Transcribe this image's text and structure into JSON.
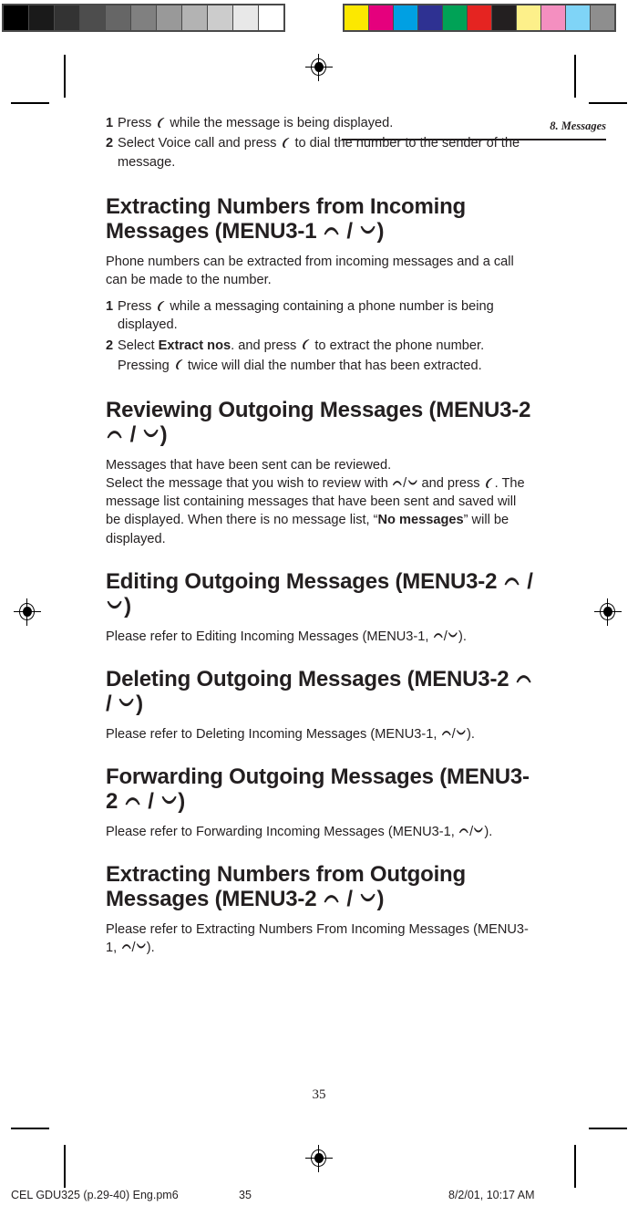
{
  "calibration": {
    "gray_bar": {
      "name": "grayscale-step-wedge",
      "swatches": [
        "#000000",
        "#1a1a1a",
        "#333333",
        "#4d4d4d",
        "#666666",
        "#808080",
        "#999999",
        "#b3b3b3",
        "#cccccc",
        "#e8e8e8",
        "#ffffff"
      ]
    },
    "color_bar": {
      "name": "process-color-bar",
      "swatches": [
        "#fce800",
        "#e5007d",
        "#00a0e3",
        "#2e3192",
        "#00a256",
        "#e52421",
        "#231f20",
        "#fdf08a",
        "#f48fc0",
        "#7fd4f7",
        "#8e8e8e"
      ]
    }
  },
  "header": {
    "running_head": "8. Messages"
  },
  "sections": [
    {
      "type": "steps",
      "name": "voice-call-steps",
      "items": [
        {
          "num": "1",
          "parts": [
            {
              "t": "text",
              "v": "Press "
            },
            {
              "t": "icon",
              "v": "send-key-icon"
            },
            {
              "t": "text",
              "v": " while the message is being displayed."
            }
          ]
        },
        {
          "num": "2",
          "parts": [
            {
              "t": "text",
              "v": "Select Voice call and press "
            },
            {
              "t": "icon",
              "v": "send-key-icon"
            },
            {
              "t": "text",
              "v": " to dial the number to the sender of the message."
            }
          ]
        }
      ]
    },
    {
      "type": "section",
      "name": "extracting-numbers-incoming",
      "heading": [
        {
          "t": "text",
          "v": "Extracting Numbers from Incoming Messages (MENU3-1 "
        },
        {
          "t": "icon",
          "v": "scroll-up-icon"
        },
        {
          "t": "text",
          "v": " / "
        },
        {
          "t": "icon",
          "v": "scroll-down-icon"
        },
        {
          "t": "text",
          "v": ")"
        }
      ],
      "paragraphs": [
        [
          {
            "t": "text",
            "v": "Phone numbers can be extracted from incoming messages and a call can be made to the number."
          }
        ]
      ],
      "steps": [
        {
          "num": "1",
          "parts": [
            {
              "t": "text",
              "v": "Press "
            },
            {
              "t": "icon",
              "v": "send-key-icon"
            },
            {
              "t": "text",
              "v": " while a messaging containing a phone number is being displayed."
            }
          ]
        },
        {
          "num": "2",
          "parts": [
            {
              "t": "text",
              "v": "Select "
            },
            {
              "t": "bold",
              "v": "Extract nos"
            },
            {
              "t": "text",
              "v": ". and press "
            },
            {
              "t": "icon",
              "v": "send-key-icon"
            },
            {
              "t": "text",
              "v": " to extract the phone number."
            }
          ]
        },
        {
          "num": "",
          "parts": [
            {
              "t": "text",
              "v": "Pressing "
            },
            {
              "t": "icon",
              "v": "send-key-icon"
            },
            {
              "t": "text",
              "v": " twice will dial the number that has been extracted."
            }
          ]
        }
      ]
    },
    {
      "type": "section",
      "name": "reviewing-outgoing-messages",
      "heading": [
        {
          "t": "text",
          "v": "Reviewing Outgoing Messages (MENU3-2 "
        },
        {
          "t": "icon",
          "v": "scroll-up-icon"
        },
        {
          "t": "text",
          "v": " / "
        },
        {
          "t": "icon",
          "v": "scroll-down-icon"
        },
        {
          "t": "text",
          "v": ")"
        }
      ],
      "paragraphs": [
        [
          {
            "t": "text",
            "v": "Messages that have been sent can be reviewed."
          },
          {
            "t": "br",
            "v": ""
          },
          {
            "t": "text",
            "v": "Select the message that you wish to review with "
          },
          {
            "t": "icon",
            "v": "scroll-up-icon"
          },
          {
            "t": "text",
            "v": "/"
          },
          {
            "t": "icon",
            "v": "scroll-down-icon"
          },
          {
            "t": "text",
            "v": " and press "
          },
          {
            "t": "icon",
            "v": "send-key-icon"
          },
          {
            "t": "text",
            "v": ". The message list containing messages that have been sent and saved will be displayed. When there is no message list, “"
          },
          {
            "t": "bold",
            "v": "No messages"
          },
          {
            "t": "text",
            "v": "” will be displayed."
          }
        ]
      ],
      "steps": []
    },
    {
      "type": "section",
      "name": "editing-outgoing-messages",
      "heading": [
        {
          "t": "text",
          "v": "Editing Outgoing Messages (MENU3-2 "
        },
        {
          "t": "icon",
          "v": "scroll-up-icon"
        },
        {
          "t": "text",
          "v": " / "
        },
        {
          "t": "icon",
          "v": "scroll-down-icon"
        },
        {
          "t": "text",
          "v": ")"
        }
      ],
      "paragraphs": [
        [
          {
            "t": "text",
            "v": "Please refer to Editing Incoming Messages (MENU3-1, "
          },
          {
            "t": "icon",
            "v": "scroll-up-icon"
          },
          {
            "t": "text",
            "v": "/"
          },
          {
            "t": "icon",
            "v": "scroll-down-icon"
          },
          {
            "t": "text",
            "v": ")."
          }
        ]
      ],
      "steps": []
    },
    {
      "type": "section",
      "name": "deleting-outgoing-messages",
      "heading": [
        {
          "t": "text",
          "v": "Deleting Outgoing Messages (MENU3-2 "
        },
        {
          "t": "icon",
          "v": "scroll-up-icon"
        },
        {
          "t": "text",
          "v": " / "
        },
        {
          "t": "icon",
          "v": "scroll-down-icon"
        },
        {
          "t": "text",
          "v": ")"
        }
      ],
      "paragraphs": [
        [
          {
            "t": "text",
            "v": "Please refer to Deleting Incoming Messages (MENU3-1, "
          },
          {
            "t": "icon",
            "v": "scroll-up-icon"
          },
          {
            "t": "text",
            "v": "/"
          },
          {
            "t": "icon",
            "v": "scroll-down-icon"
          },
          {
            "t": "text",
            "v": ")."
          }
        ]
      ],
      "steps": []
    },
    {
      "type": "section",
      "name": "forwarding-outgoing-messages",
      "heading": [
        {
          "t": "text",
          "v": "Forwarding Outgoing Messages (MENU3-2 "
        },
        {
          "t": "icon",
          "v": "scroll-up-icon"
        },
        {
          "t": "text",
          "v": " / "
        },
        {
          "t": "icon",
          "v": "scroll-down-icon"
        },
        {
          "t": "text",
          "v": ")"
        }
      ],
      "paragraphs": [
        [
          {
            "t": "text",
            "v": "Please refer to Forwarding Incoming Messages (MENU3-1, "
          },
          {
            "t": "icon",
            "v": "scroll-up-icon"
          },
          {
            "t": "text",
            "v": "/"
          },
          {
            "t": "icon",
            "v": "scroll-down-icon"
          },
          {
            "t": "text",
            "v": ")."
          }
        ]
      ],
      "steps": []
    },
    {
      "type": "section",
      "name": "extracting-numbers-outgoing",
      "heading": [
        {
          "t": "text",
          "v": "Extracting Numbers from Outgoing Messages (MENU3-2 "
        },
        {
          "t": "icon",
          "v": "scroll-up-icon"
        },
        {
          "t": "text",
          "v": " / "
        },
        {
          "t": "icon",
          "v": "scroll-down-icon"
        },
        {
          "t": "text",
          "v": ")"
        }
      ],
      "paragraphs": [
        [
          {
            "t": "text",
            "v": "Please refer to Extracting Numbers From Incoming Messages (MENU3-1, "
          },
          {
            "t": "icon",
            "v": "scroll-up-icon"
          },
          {
            "t": "text",
            "v": "/"
          },
          {
            "t": "icon",
            "v": "scroll-down-icon"
          },
          {
            "t": "text",
            "v": ")."
          }
        ]
      ],
      "steps": []
    }
  ],
  "folio": {
    "page_number": "35"
  },
  "slug": {
    "file": "CEL GDU325 (p.29-40) Eng.pm6",
    "page": "35",
    "date": "8/2/01, 10:17 AM"
  }
}
